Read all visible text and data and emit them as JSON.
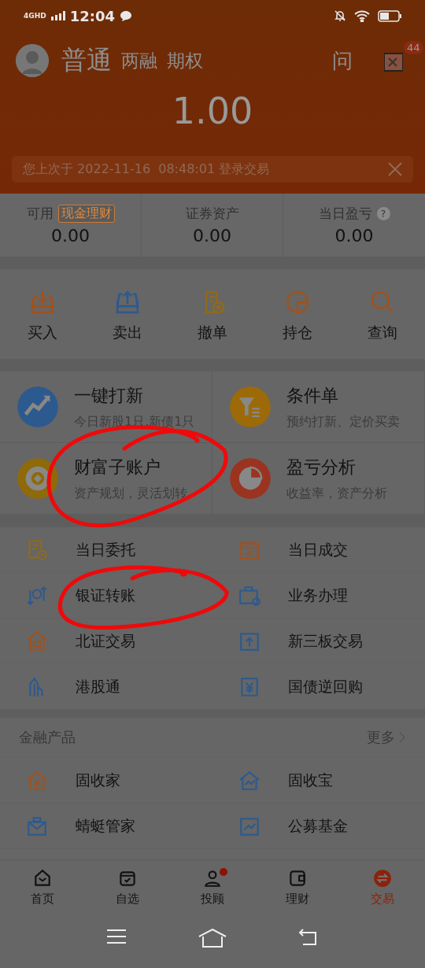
{
  "status_bar": {
    "network": "4GHD",
    "time": "12:04"
  },
  "header": {
    "account_types": [
      {
        "label": "普通",
        "selected": true
      },
      {
        "label": "两融",
        "selected": false
      },
      {
        "label": "期权",
        "selected": false
      }
    ],
    "help": "问",
    "message_badge": "44",
    "balance": "1.00",
    "notice": "您上次于 2022-11-16  08:48:01 登录交易"
  },
  "summary": [
    {
      "label": "可用",
      "tag": "现金理财",
      "value": "0.00"
    },
    {
      "label": "证券资产",
      "value": "0.00"
    },
    {
      "label": "当日盈亏",
      "help": "?",
      "value": "0.00"
    }
  ],
  "actions": [
    {
      "label": "买入",
      "kind": "buy"
    },
    {
      "label": "卖出",
      "kind": "sell"
    },
    {
      "label": "撤单",
      "kind": "cancel"
    },
    {
      "label": "持仓",
      "kind": "position"
    },
    {
      "label": "查询",
      "kind": "search"
    }
  ],
  "features": [
    {
      "title": "一键打新",
      "subtitle": "今日新股1只,新债1只",
      "kind": "ipo",
      "color": "#2c5a8e"
    },
    {
      "title": "条件单",
      "subtitle": "预约打新、定价买卖",
      "kind": "filter",
      "color": "#9c6a08"
    },
    {
      "title": "财富子账户",
      "subtitle": "资产规划，灵活划转",
      "kind": "coin",
      "color": "#8f6a0a"
    },
    {
      "title": "盈亏分析",
      "subtitle": "收益率，资产分析",
      "kind": "pie",
      "color": "#9a3420"
    }
  ],
  "tools": [
    {
      "label": "当日委托",
      "kind": "doc-clock"
    },
    {
      "label": "当日成交",
      "kind": "calendar"
    },
    {
      "label": "银证转账",
      "kind": "transfer"
    },
    {
      "label": "业务办理",
      "kind": "briefcase"
    },
    {
      "label": "北证交易",
      "kind": "house"
    },
    {
      "label": "新三板交易",
      "kind": "board"
    },
    {
      "label": "港股通",
      "kind": "bridge"
    },
    {
      "label": "国债逆回购",
      "kind": "yen-ticket"
    }
  ],
  "products": {
    "title": "金融产品",
    "more": "更多",
    "items": [
      {
        "label": "固收家",
        "kind": "yen-house"
      },
      {
        "label": "固收宝",
        "kind": "chart-house"
      },
      {
        "label": "蜻蜓管家",
        "kind": "mail"
      },
      {
        "label": "公募基金",
        "kind": "chart"
      }
    ]
  },
  "tab_bar": [
    {
      "label": "首页",
      "kind": "home",
      "selected": false,
      "dot": false
    },
    {
      "label": "自选",
      "kind": "box",
      "selected": false,
      "dot": false
    },
    {
      "label": "投顾",
      "kind": "person",
      "selected": false,
      "dot": true
    },
    {
      "label": "理财",
      "kind": "wallet",
      "selected": false,
      "dot": false
    },
    {
      "label": "交易",
      "kind": "swap",
      "selected": true,
      "dot": false
    }
  ],
  "annotations": [
    {
      "kind": "ring"
    },
    {
      "kind": "ring"
    }
  ]
}
